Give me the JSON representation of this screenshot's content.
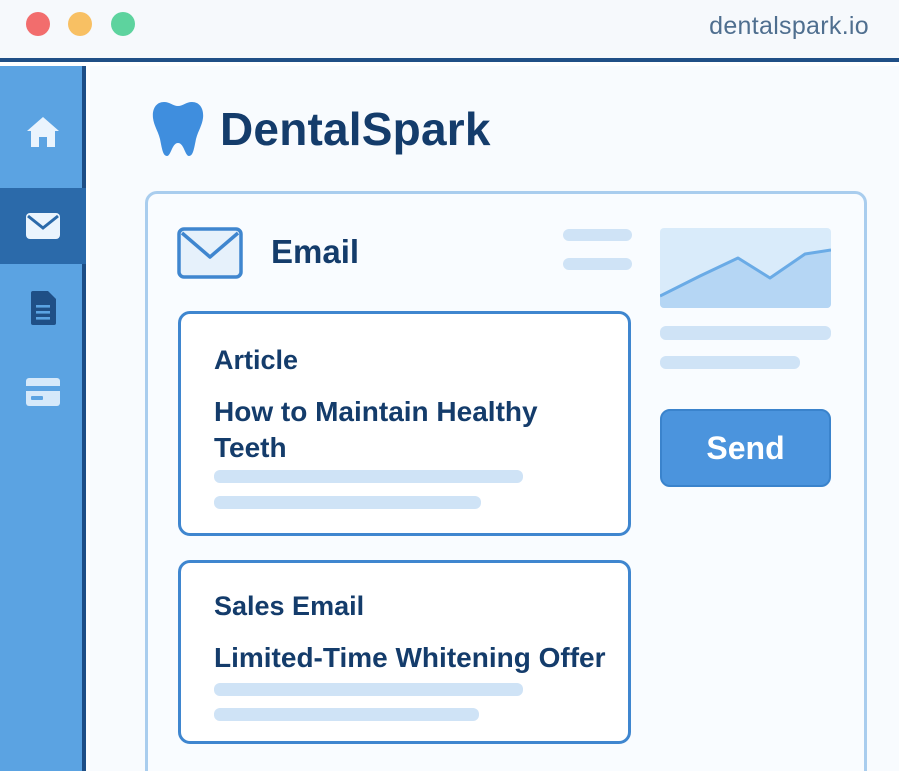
{
  "window": {
    "url": "dentalspark.io"
  },
  "sidebar": {
    "items": [
      {
        "icon": "home-icon"
      },
      {
        "icon": "mail-icon",
        "active": true
      },
      {
        "icon": "document-icon"
      },
      {
        "icon": "card-icon"
      }
    ]
  },
  "brand": {
    "name": "DentalSpark",
    "icon": "tooth-icon"
  },
  "panel": {
    "title": "Email",
    "icon": "envelope-icon",
    "items": [
      {
        "type": "Article",
        "headline": "How to Maintain Healthy Teeth"
      },
      {
        "type": "Sales Email",
        "headline": "Limited-Time Whitening Offer"
      }
    ],
    "send_label": "Send"
  },
  "colors": {
    "accent": "#4b94dd",
    "dark": "#143c6b",
    "sidebar": "#5ba3e2",
    "sidebar_active": "#2b6aaa"
  }
}
